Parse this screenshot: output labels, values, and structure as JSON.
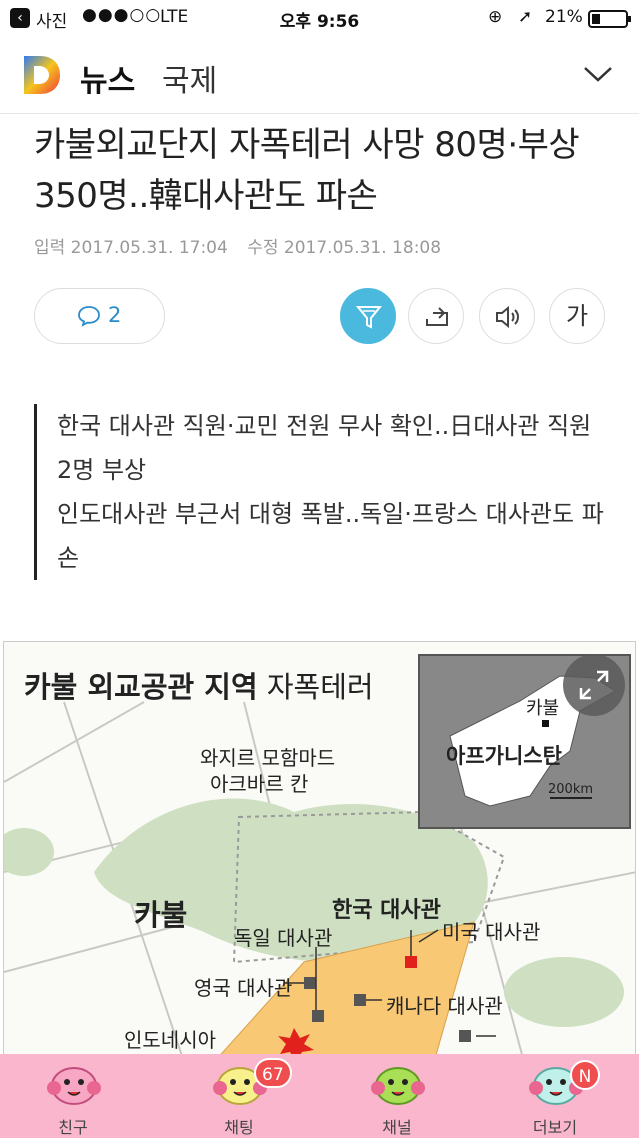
{
  "status_bar": {
    "back_app": "사진",
    "signal": "●●●○○",
    "carrier": "LTE",
    "time": "오후 9:56",
    "battery": "21%"
  },
  "header": {
    "section": "뉴스",
    "category": "국제"
  },
  "article": {
    "title": "카불외교단지 자폭테러 사망 80명·부상 350명..韓대사관도 파손",
    "published": "입력 2017.05.31. 17:04",
    "modified": "수정 2017.05.31. 18:08",
    "comment_count": "2",
    "font_button": "가",
    "summary": [
      "한국 대사관 직원·교민 전원 무사 확인..日대사관 직원 2명 부상",
      "인도대사관 부근서 대형 폭발..독일·프랑스 대사관도 파손"
    ]
  },
  "map": {
    "title_bold": "카불 외교공관 지역",
    "title_rest": "자폭테러",
    "inset_city": "카불",
    "inset_country": "아프가니스탄",
    "inset_scale": "200km",
    "labels": {
      "palace_line1": "와지르 모함마드",
      "palace_line2": "아크바르 칸",
      "kabul": "카불",
      "korea": "한국 대사관",
      "germany": "독일 대사관",
      "usa": "미국 대사관",
      "uk": "영국 대사관",
      "canada": "캐나다 대사관",
      "indonesia": "인도네시아"
    }
  },
  "tabbar": {
    "tabs": [
      {
        "label": "친구"
      },
      {
        "label": "채팅",
        "badge": "67"
      },
      {
        "label": "채널"
      },
      {
        "label": "더보기",
        "badge": "N"
      }
    ]
  },
  "colors": {
    "accent": "#4bb8de",
    "tab_bg": "#f9b6cd",
    "badge": "#f04e4e",
    "map_zone": "#f8c874",
    "korea_marker": "#e0211c"
  }
}
